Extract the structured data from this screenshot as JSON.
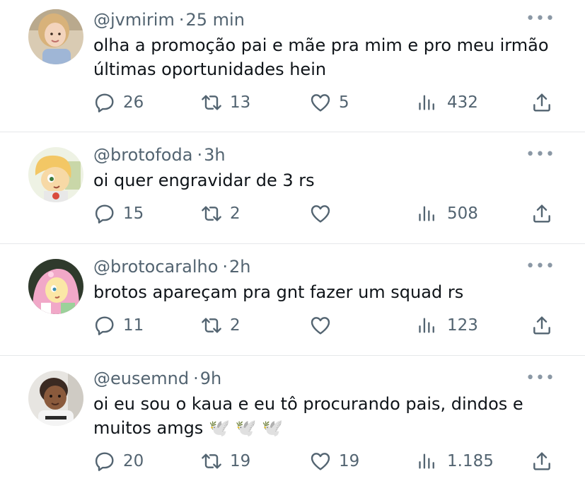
{
  "tweets": [
    {
      "handle": "@jvmirim",
      "separator": "·",
      "time": "25 min",
      "text": "olha a promoção pai e mãe pra mim e pro meu irmão\núltimas oportunidades hein",
      "replies": "26",
      "retweets": "13",
      "likes": "5",
      "views": "432",
      "more": "•••"
    },
    {
      "handle": "@brotofoda",
      "separator": "·",
      "time": "3h",
      "text": "oi quer engravidar de 3 rs",
      "replies": "15",
      "retweets": "2",
      "likes": "",
      "views": "508",
      "more": "•••"
    },
    {
      "handle": "@brotocaralho",
      "separator": "·",
      "time": "2h",
      "text": "brotos apareçam pra gnt fazer um squad rs",
      "replies": "11",
      "retweets": "2",
      "likes": "",
      "views": "123",
      "more": "•••"
    },
    {
      "handle": "@eusemnd",
      "separator": "·",
      "time": "9h",
      "text": "oi eu sou o kaua e eu tô procurando pais, dindos e\nmuitos amgs 🕊️ 🕊️ 🕊️",
      "replies": "20",
      "retweets": "19",
      "likes": "19",
      "views": "1.185",
      "more": "•••"
    }
  ],
  "colors": {
    "text": "#0f1419",
    "secondary": "#536471",
    "divider": "#e6e8ea"
  },
  "icons": [
    "reply-icon",
    "retweet-icon",
    "like-icon",
    "views-icon",
    "share-icon",
    "more-icon"
  ]
}
